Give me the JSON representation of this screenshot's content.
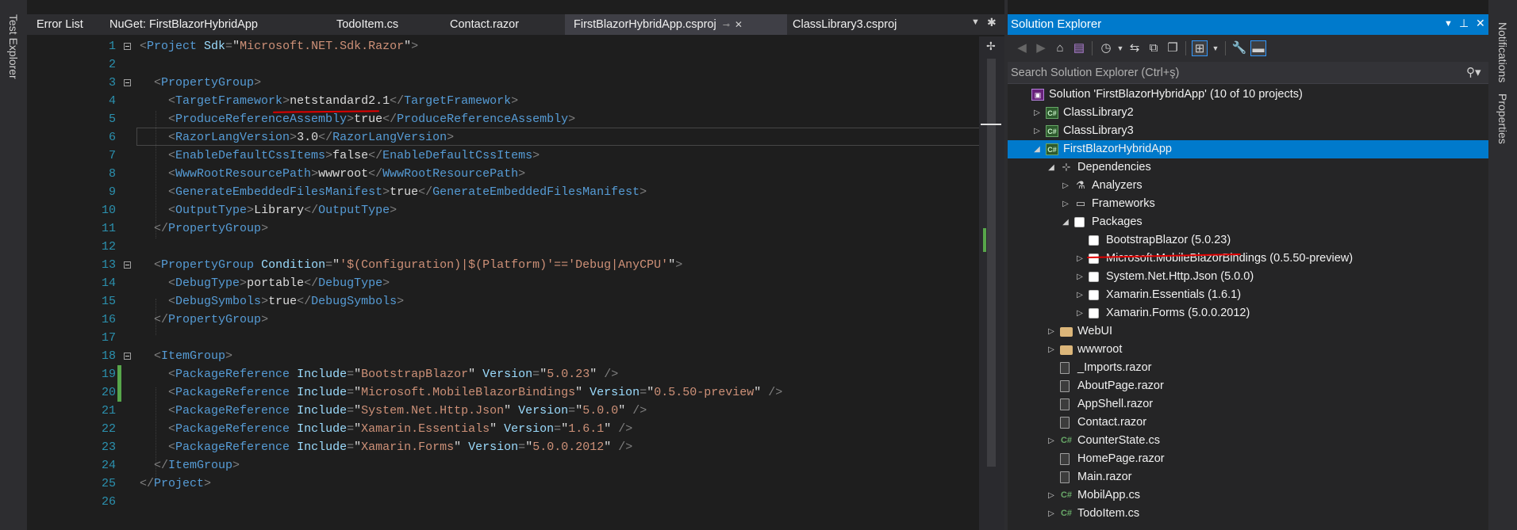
{
  "left_rail": {
    "label": "Test Explorer"
  },
  "right_rail": {
    "labels": [
      "Notifications",
      "Properties"
    ]
  },
  "tabs": [
    {
      "label": "Error List"
    },
    {
      "label": "NuGet: FirstBlazorHybridApp"
    },
    {
      "label": "TodoItem.cs"
    },
    {
      "label": "Contact.razor"
    },
    {
      "label": "FirstBlazorHybridApp.csproj"
    },
    {
      "label": "ClassLibrary3.csproj"
    }
  ],
  "editor": {
    "lines": [
      {
        "n": "1",
        "parts": [
          [
            "br",
            "<"
          ],
          [
            "tag",
            "Project "
          ],
          [
            "attr",
            "Sdk"
          ],
          [
            "br",
            "="
          ],
          [
            "text",
            "\""
          ],
          [
            "val",
            "Microsoft.NET.Sdk.Razor"
          ],
          [
            "text",
            "\""
          ],
          [
            "br",
            ">"
          ]
        ]
      },
      {
        "n": "2",
        "parts": []
      },
      {
        "n": "3",
        "parts": [
          [
            "text",
            "  "
          ],
          [
            "br",
            "<"
          ],
          [
            "tag",
            "PropertyGroup"
          ],
          [
            "br",
            ">"
          ]
        ]
      },
      {
        "n": "4",
        "parts": [
          [
            "text",
            "    "
          ],
          [
            "br",
            "<"
          ],
          [
            "tag",
            "TargetFramework"
          ],
          [
            "br",
            ">"
          ],
          [
            "text",
            "netstandard2.1"
          ],
          [
            "br",
            "</"
          ],
          [
            "tag",
            "TargetFramework"
          ],
          [
            "br",
            ">"
          ]
        ]
      },
      {
        "n": "5",
        "parts": [
          [
            "text",
            "    "
          ],
          [
            "br",
            "<"
          ],
          [
            "tag",
            "ProduceReferenceAssembly"
          ],
          [
            "br",
            ">"
          ],
          [
            "text",
            "true"
          ],
          [
            "br",
            "</"
          ],
          [
            "tag",
            "ProduceReferenceAssembly"
          ],
          [
            "br",
            ">"
          ]
        ]
      },
      {
        "n": "6",
        "parts": [
          [
            "text",
            "    "
          ],
          [
            "br",
            "<"
          ],
          [
            "tag",
            "RazorLangVersion"
          ],
          [
            "br",
            ">"
          ],
          [
            "text",
            "3.0"
          ],
          [
            "br",
            "</"
          ],
          [
            "tag",
            "RazorLangVersion"
          ],
          [
            "br",
            ">"
          ]
        ]
      },
      {
        "n": "7",
        "parts": [
          [
            "text",
            "    "
          ],
          [
            "br",
            "<"
          ],
          [
            "tag",
            "EnableDefaultCssItems"
          ],
          [
            "br",
            ">"
          ],
          [
            "text",
            "false"
          ],
          [
            "br",
            "</"
          ],
          [
            "tag",
            "EnableDefaultCssItems"
          ],
          [
            "br",
            ">"
          ]
        ]
      },
      {
        "n": "8",
        "parts": [
          [
            "text",
            "    "
          ],
          [
            "br",
            "<"
          ],
          [
            "tag",
            "WwwRootResourcePath"
          ],
          [
            "br",
            ">"
          ],
          [
            "text",
            "wwwroot"
          ],
          [
            "br",
            "</"
          ],
          [
            "tag",
            "WwwRootResourcePath"
          ],
          [
            "br",
            ">"
          ]
        ]
      },
      {
        "n": "9",
        "parts": [
          [
            "text",
            "    "
          ],
          [
            "br",
            "<"
          ],
          [
            "tag",
            "GenerateEmbeddedFilesManifest"
          ],
          [
            "br",
            ">"
          ],
          [
            "text",
            "true"
          ],
          [
            "br",
            "</"
          ],
          [
            "tag",
            "GenerateEmbeddedFilesManifest"
          ],
          [
            "br",
            ">"
          ]
        ]
      },
      {
        "n": "10",
        "parts": [
          [
            "text",
            "    "
          ],
          [
            "br",
            "<"
          ],
          [
            "tag",
            "OutputType"
          ],
          [
            "br",
            ">"
          ],
          [
            "text",
            "Library"
          ],
          [
            "br",
            "</"
          ],
          [
            "tag",
            "OutputType"
          ],
          [
            "br",
            ">"
          ]
        ]
      },
      {
        "n": "11",
        "parts": [
          [
            "text",
            "  "
          ],
          [
            "br",
            "</"
          ],
          [
            "tag",
            "PropertyGroup"
          ],
          [
            "br",
            ">"
          ]
        ]
      },
      {
        "n": "12",
        "parts": []
      },
      {
        "n": "13",
        "parts": [
          [
            "text",
            "  "
          ],
          [
            "br",
            "<"
          ],
          [
            "tag",
            "PropertyGroup "
          ],
          [
            "attr",
            "Condition"
          ],
          [
            "br",
            "="
          ],
          [
            "text",
            "\""
          ],
          [
            "val",
            "'$(Configuration)|$(Platform)'=='Debug|AnyCPU'"
          ],
          [
            "text",
            "\""
          ],
          [
            "br",
            ">"
          ]
        ]
      },
      {
        "n": "14",
        "parts": [
          [
            "text",
            "    "
          ],
          [
            "br",
            "<"
          ],
          [
            "tag",
            "DebugType"
          ],
          [
            "br",
            ">"
          ],
          [
            "text",
            "portable"
          ],
          [
            "br",
            "</"
          ],
          [
            "tag",
            "DebugType"
          ],
          [
            "br",
            ">"
          ]
        ]
      },
      {
        "n": "15",
        "parts": [
          [
            "text",
            "    "
          ],
          [
            "br",
            "<"
          ],
          [
            "tag",
            "DebugSymbols"
          ],
          [
            "br",
            ">"
          ],
          [
            "text",
            "true"
          ],
          [
            "br",
            "</"
          ],
          [
            "tag",
            "DebugSymbols"
          ],
          [
            "br",
            ">"
          ]
        ]
      },
      {
        "n": "16",
        "parts": [
          [
            "text",
            "  "
          ],
          [
            "br",
            "</"
          ],
          [
            "tag",
            "PropertyGroup"
          ],
          [
            "br",
            ">"
          ]
        ]
      },
      {
        "n": "17",
        "parts": []
      },
      {
        "n": "18",
        "parts": [
          [
            "text",
            "  "
          ],
          [
            "br",
            "<"
          ],
          [
            "tag",
            "ItemGroup"
          ],
          [
            "br",
            ">"
          ]
        ]
      },
      {
        "n": "19",
        "parts": [
          [
            "text",
            "    "
          ],
          [
            "br",
            "<"
          ],
          [
            "tag",
            "PackageReference "
          ],
          [
            "attr",
            "Include"
          ],
          [
            "br",
            "="
          ],
          [
            "text",
            "\""
          ],
          [
            "val",
            "BootstrapBlazor"
          ],
          [
            "text",
            "\" "
          ],
          [
            "attr",
            "Version"
          ],
          [
            "br",
            "="
          ],
          [
            "text",
            "\""
          ],
          [
            "val",
            "5.0.23"
          ],
          [
            "text",
            "\" "
          ],
          [
            "br",
            "/>"
          ]
        ]
      },
      {
        "n": "20",
        "parts": [
          [
            "text",
            "    "
          ],
          [
            "br",
            "<"
          ],
          [
            "tag",
            "PackageReference "
          ],
          [
            "attr",
            "Include"
          ],
          [
            "br",
            "="
          ],
          [
            "text",
            "\""
          ],
          [
            "val",
            "Microsoft.MobileBlazorBindings"
          ],
          [
            "text",
            "\" "
          ],
          [
            "attr",
            "Version"
          ],
          [
            "br",
            "="
          ],
          [
            "text",
            "\""
          ],
          [
            "val",
            "0.5.50-preview"
          ],
          [
            "text",
            "\" "
          ],
          [
            "br",
            "/>"
          ]
        ]
      },
      {
        "n": "21",
        "parts": [
          [
            "text",
            "    "
          ],
          [
            "br",
            "<"
          ],
          [
            "tag",
            "PackageReference "
          ],
          [
            "attr",
            "Include"
          ],
          [
            "br",
            "="
          ],
          [
            "text",
            "\""
          ],
          [
            "val",
            "System.Net.Http.Json"
          ],
          [
            "text",
            "\" "
          ],
          [
            "attr",
            "Version"
          ],
          [
            "br",
            "="
          ],
          [
            "text",
            "\""
          ],
          [
            "val",
            "5.0.0"
          ],
          [
            "text",
            "\" "
          ],
          [
            "br",
            "/>"
          ]
        ]
      },
      {
        "n": "22",
        "parts": [
          [
            "text",
            "    "
          ],
          [
            "br",
            "<"
          ],
          [
            "tag",
            "PackageReference "
          ],
          [
            "attr",
            "Include"
          ],
          [
            "br",
            "="
          ],
          [
            "text",
            "\""
          ],
          [
            "val",
            "Xamarin.Essentials"
          ],
          [
            "text",
            "\" "
          ],
          [
            "attr",
            "Version"
          ],
          [
            "br",
            "="
          ],
          [
            "text",
            "\""
          ],
          [
            "val",
            "1.6.1"
          ],
          [
            "text",
            "\" "
          ],
          [
            "br",
            "/>"
          ]
        ]
      },
      {
        "n": "23",
        "parts": [
          [
            "text",
            "    "
          ],
          [
            "br",
            "<"
          ],
          [
            "tag",
            "PackageReference "
          ],
          [
            "attr",
            "Include"
          ],
          [
            "br",
            "="
          ],
          [
            "text",
            "\""
          ],
          [
            "val",
            "Xamarin.Forms"
          ],
          [
            "text",
            "\" "
          ],
          [
            "attr",
            "Version"
          ],
          [
            "br",
            "="
          ],
          [
            "text",
            "\""
          ],
          [
            "val",
            "5.0.0.2012"
          ],
          [
            "text",
            "\" "
          ],
          [
            "br",
            "/>"
          ]
        ]
      },
      {
        "n": "24",
        "parts": [
          [
            "text",
            "  "
          ],
          [
            "br",
            "</"
          ],
          [
            "tag",
            "ItemGroup"
          ],
          [
            "br",
            ">"
          ]
        ]
      },
      {
        "n": "25",
        "parts": [
          [
            "br",
            "</"
          ],
          [
            "tag",
            "Project"
          ],
          [
            "br",
            ">"
          ]
        ]
      },
      {
        "n": "26",
        "parts": []
      }
    ]
  },
  "solution_explorer": {
    "title": "Solution Explorer",
    "search_placeholder": "Search Solution Explorer (Ctrl+ş)",
    "items": [
      {
        "label": "Solution 'FirstBlazorHybridApp' (10 of 10 projects)",
        "icon": "solution-icon",
        "arrow": ""
      },
      {
        "label": "ClassLibrary2",
        "icon": "csharp-project-icon",
        "arrow": "right"
      },
      {
        "label": "ClassLibrary3",
        "icon": "csharp-project-icon",
        "arrow": "right"
      },
      {
        "label": "FirstBlazorHybridApp",
        "icon": "csharp-project-icon",
        "arrow": "down"
      },
      {
        "label": "Dependencies",
        "icon": "dependencies-icon",
        "arrow": "down"
      },
      {
        "label": "Analyzers",
        "icon": "analyzer-icon",
        "arrow": "right"
      },
      {
        "label": "Frameworks",
        "icon": "framework-icon",
        "arrow": "right"
      },
      {
        "label": "Packages",
        "icon": "package-icon",
        "arrow": "down"
      },
      {
        "label": "BootstrapBlazor (5.0.23)",
        "icon": "package-icon",
        "arrow": ""
      },
      {
        "label": "Microsoft.MobileBlazorBindings (0.5.50-preview)",
        "icon": "package-icon",
        "arrow": "right"
      },
      {
        "label": "System.Net.Http.Json (5.0.0)",
        "icon": "package-icon",
        "arrow": "right"
      },
      {
        "label": "Xamarin.Essentials (1.6.1)",
        "icon": "package-icon",
        "arrow": "right"
      },
      {
        "label": "Xamarin.Forms (5.0.0.2012)",
        "icon": "package-icon",
        "arrow": "right"
      },
      {
        "label": "WebUI",
        "icon": "folder-icon",
        "arrow": "right"
      },
      {
        "label": "wwwroot",
        "icon": "folder-icon",
        "arrow": "right"
      },
      {
        "label": "_Imports.razor",
        "icon": "razor-file-icon",
        "arrow": ""
      },
      {
        "label": "AboutPage.razor",
        "icon": "razor-file-icon",
        "arrow": ""
      },
      {
        "label": "AppShell.razor",
        "icon": "razor-file-icon",
        "arrow": ""
      },
      {
        "label": "Contact.razor",
        "icon": "razor-file-icon",
        "arrow": ""
      },
      {
        "label": "CounterState.cs",
        "icon": "csharp-file-icon",
        "arrow": "right"
      },
      {
        "label": "HomePage.razor",
        "icon": "razor-file-icon",
        "arrow": ""
      },
      {
        "label": "Main.razor",
        "icon": "razor-file-icon",
        "arrow": ""
      },
      {
        "label": "MobilApp.cs",
        "icon": "csharp-file-icon",
        "arrow": "right"
      },
      {
        "label": "TodoItem.cs",
        "icon": "csharp-file-icon",
        "arrow": "right"
      }
    ]
  }
}
